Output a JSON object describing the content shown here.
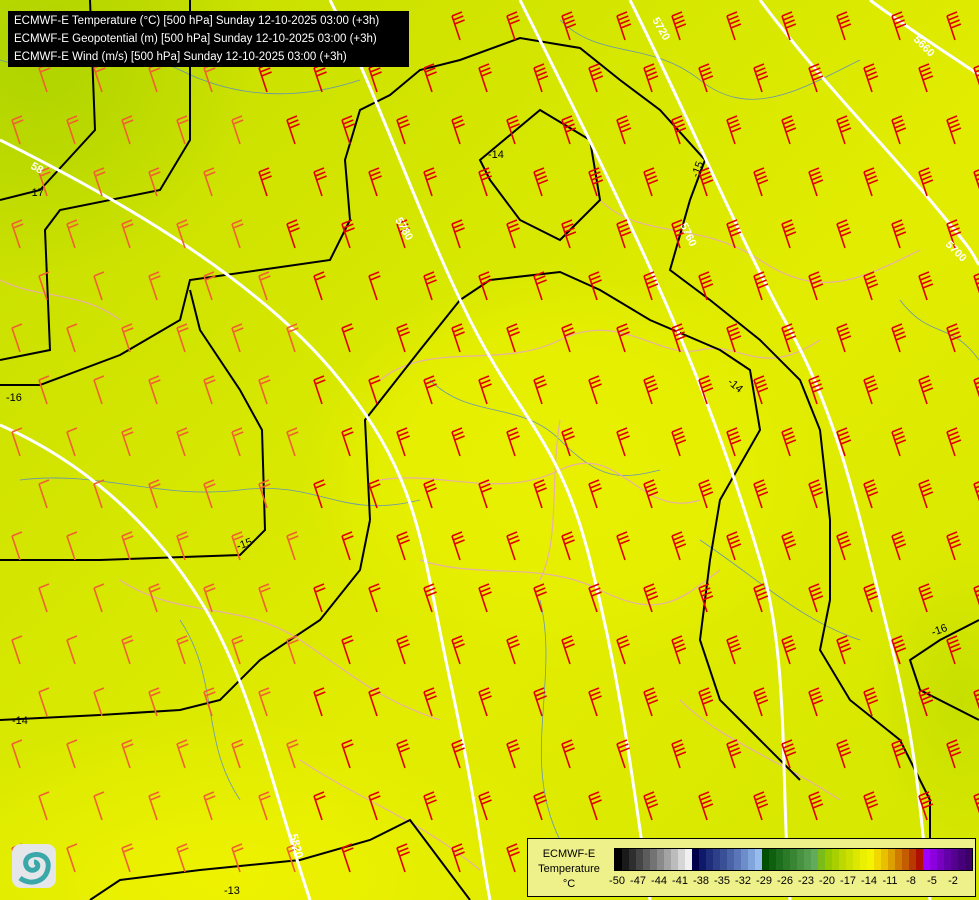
{
  "title_lines": [
    "ECMWF-E Temperature (°C) [500 hPa] Sunday 12-10-2025 03:00 (+3h)",
    "ECMWF-E Geopotential (m) [500 hPa] Sunday 12-10-2025 03:00 (+3h)",
    "ECMWF-E Wind (m/s) [500 hPa] Sunday 12-10-2025 03:00 (+3h)"
  ],
  "legend": {
    "title_line1": "ECMWF-E",
    "title_line2": "Temperature",
    "unit": "°C",
    "tick_labels": [
      "-50",
      "-47",
      "-44",
      "-41",
      "-38",
      "-35",
      "-32",
      "-29",
      "-26",
      "-23",
      "-20",
      "-17",
      "-14",
      "-11",
      "-8",
      "-5",
      "-2"
    ],
    "range": [
      -50,
      0
    ],
    "colors": [
      "#000000",
      "#1a1a1a",
      "#2e2e2e",
      "#454545",
      "#5c5c5c",
      "#737373",
      "#8a8a8a",
      "#a3a3a3",
      "#bcbcbc",
      "#d6d6d6",
      "#f0f0f0",
      "#00004a",
      "#10186a",
      "#1e2e7a",
      "#2c3f88",
      "#3a5096",
      "#4a62a6",
      "#5a76b8",
      "#6c8cca",
      "#80a4dc",
      "#98bcee",
      "#005000",
      "#0e6010",
      "#1c6e1c",
      "#2a7a28",
      "#388634",
      "#469240",
      "#549e4e",
      "#62aa5c",
      "#7cbc18",
      "#94c800",
      "#a8d000",
      "#bcd800",
      "#cce000",
      "#dce800",
      "#eaf000",
      "#f4f400",
      "#f0d800",
      "#e8c000",
      "#dca000",
      "#d07c00",
      "#c45c00",
      "#b83800",
      "#b01000",
      "#a000ff",
      "#8c00e0",
      "#7800c0",
      "#6400a8",
      "#540090",
      "#46007a",
      "#3c0068"
    ]
  },
  "geopotential_labels": [
    "5780",
    "5720",
    "5660",
    "5700",
    "5760",
    "5820",
    "58"
  ],
  "temperature_labels": [
    "-14",
    "-15",
    "-17",
    "-16",
    "-15",
    "-14",
    "-16",
    "-14",
    "-13"
  ],
  "colors": {
    "geopotential": "#ffffff",
    "temperature": "#000000",
    "wind_barb": "#e00000",
    "border": "#e8b0a8",
    "river": "#4a80e0"
  }
}
